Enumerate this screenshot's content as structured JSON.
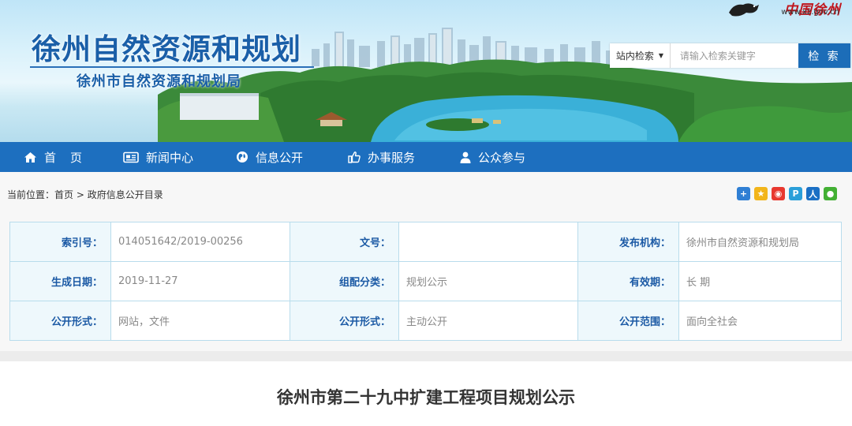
{
  "header": {
    "site_title": "徐州自然资源和规划",
    "site_subtitle": "徐州市自然资源和规划局",
    "logo_text": "中国徐州",
    "logo_url": "www.xz.gov.cn"
  },
  "search": {
    "scope_label": "站内检索",
    "placeholder": "请输入检索关键字",
    "button_label": "检 索"
  },
  "nav": {
    "items": [
      {
        "label": "首页",
        "icon": "home-icon"
      },
      {
        "label": "新闻中心",
        "icon": "newspaper-icon"
      },
      {
        "label": "信息公开",
        "icon": "globe-icon"
      },
      {
        "label": "办事服务",
        "icon": "thumbs-up-icon"
      },
      {
        "label": "公众参与",
        "icon": "user-icon"
      }
    ]
  },
  "breadcrumb": {
    "prefix": "当前位置：",
    "items": [
      "首页",
      "政府信息公开目录"
    ],
    "separator": ">"
  },
  "share": {
    "icons": [
      {
        "name": "share-plus-icon",
        "color": "#2f7fd4"
      },
      {
        "name": "qzone-icon",
        "color": "#f2b51b"
      },
      {
        "name": "weibo-icon",
        "color": "#e8382f"
      },
      {
        "name": "tencent-weibo-icon",
        "color": "#2b9fd9"
      },
      {
        "name": "renren-icon",
        "color": "#1a6fc4"
      },
      {
        "name": "wechat-icon",
        "color": "#43b034"
      }
    ]
  },
  "meta": {
    "rows": [
      [
        {
          "key": "索引号：",
          "value": "014051642/2019-00256"
        },
        {
          "key": "文号：",
          "value": ""
        },
        {
          "key": "发布机构：",
          "value": "徐州市自然资源和规划局"
        }
      ],
      [
        {
          "key": "生成日期：",
          "value": "2019-11-27"
        },
        {
          "key": "组配分类：",
          "value": "规划公示"
        },
        {
          "key": "有效期：",
          "value": "长 期"
        }
      ],
      [
        {
          "key": "公开形式：",
          "value": "网站，文件"
        },
        {
          "key": "公开形式：",
          "value": "主动公开"
        },
        {
          "key": "公开范围：",
          "value": "面向全社会"
        }
      ]
    ]
  },
  "article": {
    "title": "徐州市第二十九中扩建工程项目规划公示"
  },
  "colors": {
    "nav_bg": "#1d6fbf",
    "title_blue": "#1a5fa8",
    "key_label": "#1c5aa5",
    "table_border": "#b8dcec"
  }
}
